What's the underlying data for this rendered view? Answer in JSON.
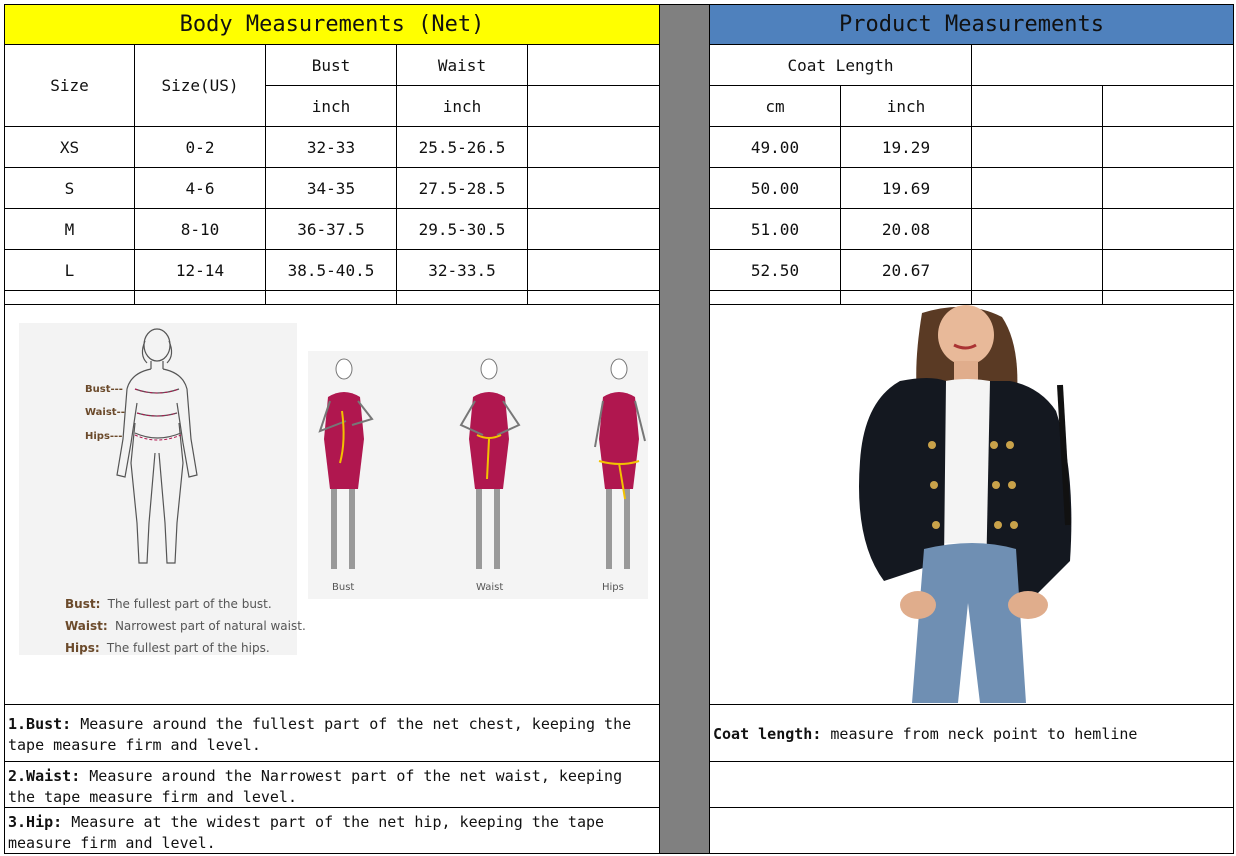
{
  "body_table": {
    "title": "Body Measurements (Net)",
    "col_size": "Size",
    "col_size_us": "Size(US)",
    "col_bust": "Bust",
    "col_waist": "Waist",
    "unit_inch_1": "inch",
    "unit_inch_2": "inch",
    "rows": [
      {
        "size": "XS",
        "us": "0-2",
        "bust": "32-33",
        "waist": "25.5-26.5"
      },
      {
        "size": "S",
        "us": "4-6",
        "bust": "34-35",
        "waist": "27.5-28.5"
      },
      {
        "size": "M",
        "us": "8-10",
        "bust": "36-37.5",
        "waist": "29.5-30.5"
      },
      {
        "size": "L",
        "us": "12-14",
        "bust": "38.5-40.5",
        "waist": "32-33.5"
      }
    ]
  },
  "product_table": {
    "title": "Product Measurements",
    "col_coat_length": "Coat Length",
    "unit_cm": "cm",
    "unit_inch": "inch",
    "rows": [
      {
        "cm": "49.00",
        "inch": "19.29"
      },
      {
        "cm": "50.00",
        "inch": "19.69"
      },
      {
        "cm": "51.00",
        "inch": "20.08"
      },
      {
        "cm": "52.50",
        "inch": "20.67"
      }
    ]
  },
  "diagram": {
    "bust_marker": "Bust---",
    "waist_marker": "Waist--",
    "hips_marker": "Hips---",
    "bust_key": "Bust:",
    "bust_desc": "The fullest part of the bust.",
    "waist_key": "Waist:",
    "waist_desc": "Narrowest part of natural waist.",
    "hips_key": "Hips:",
    "hips_desc": "The fullest part of the hips.",
    "fig_bust": "Bust",
    "fig_waist": "Waist",
    "fig_hips": "Hips",
    "dress_color": "#b0174f",
    "tape_color": "#f2c200"
  },
  "notes": {
    "bust_label": "1.Bust:",
    "bust_text": " Measure around the fullest part of the net chest, keeping the tape  measure firm and level.",
    "waist_label": "2.Waist:",
    "waist_text": " Measure around the Narrowest part of the net waist, keeping the tape  measure firm and level.",
    "hip_label": "3.Hip:",
    "hip_text": " Measure at the widest part of the net hip, keeping the tape measure firm and level.",
    "coat_label": "Coat length:",
    "coat_text": " measure from neck point to hemline"
  },
  "colors": {
    "yellow_header": "#ffff00",
    "blue_header": "#4f81bd",
    "separator_gray": "#808080",
    "jacket": "#141820",
    "jeans": "#6f8fb3"
  }
}
